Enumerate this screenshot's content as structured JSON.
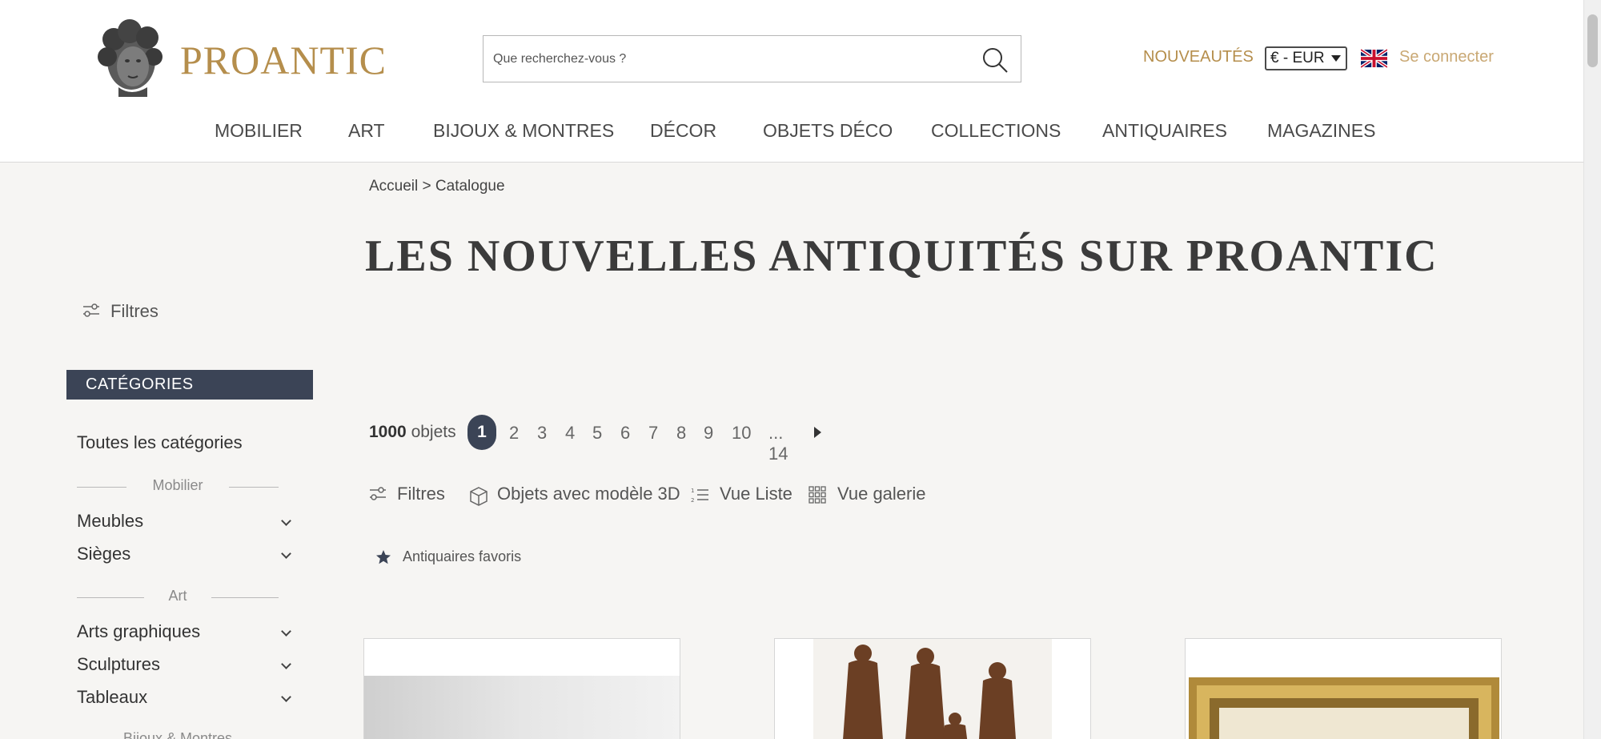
{
  "header": {
    "logo_text": "PROANTIC",
    "search_placeholder": "Que recherchez-vous ?",
    "nouveautes": "NOUVEAUTÉS",
    "currency": "€ - EUR",
    "login": "Se connecter"
  },
  "nav": [
    "MOBILIER",
    "ART",
    "BIJOUX & MONTRES",
    "DÉCOR",
    "OBJETS DÉCO",
    "COLLECTIONS",
    "ANTIQUAIRES",
    "MAGAZINES"
  ],
  "sidebar": {
    "filtres": "Filtres",
    "categories_header": "CATÉGORIES",
    "all_categories": "Toutes les catégories",
    "groups": [
      {
        "label": "Mobilier",
        "items": [
          "Meubles",
          "Sièges"
        ]
      },
      {
        "label": "Art",
        "items": [
          "Arts graphiques",
          "Sculptures",
          "Tableaux"
        ]
      },
      {
        "label": "Bijoux & Montres",
        "items": []
      }
    ]
  },
  "main": {
    "breadcrumb": "Accueil > Catalogue",
    "title": "LES NOUVELLES ANTIQUITÉS SUR PROANTIC",
    "count_number": "1000",
    "count_label": "objets",
    "pages": [
      "1",
      "2",
      "3",
      "4",
      "5",
      "6",
      "7",
      "8",
      "9",
      "10",
      "... 14"
    ],
    "current_page": "1",
    "toolbar": {
      "filtres": "Filtres",
      "objets_3d": "Objets avec modèle 3D",
      "vue_liste": "Vue Liste",
      "vue_galerie": "Vue galerie"
    },
    "antiquaires_favoris": "Antiquaires favoris"
  },
  "colors": {
    "accent_gold": "#b58e4c",
    "dark_navy": "#3b4456",
    "background": "#f6f5f3"
  }
}
